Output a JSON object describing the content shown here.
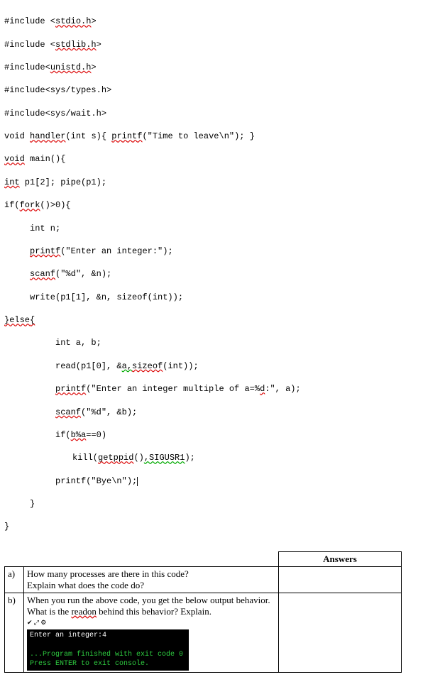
{
  "code": {
    "l1a": "#include <",
    "l1b": "stdio.h",
    "l1c": ">",
    "l2a": "#include <",
    "l2b": "stdlib.h",
    "l2c": ">",
    "l3": "#include<",
    "l3b": "unistd.h",
    "l3c": ">",
    "l4": "#include<sys/types.h>",
    "l5": "#include<sys/wait.h>",
    "l6a": "void ",
    "l6b": "handler",
    "l6c": "(int s){ ",
    "l6d": "printf",
    "l6e": "(\"Time to leave\\n\"); }",
    "l7a": "void",
    "l7b": " main(){",
    "l8a": "int",
    "l8b": " p1[2]; pipe(p1);",
    "l9a": "if(",
    "l9b": "fork",
    "l9c": "()>0){",
    "l10": "int n;",
    "l11a": "printf",
    "l11b": "(\"Enter an integer:\");",
    "l12a": "scanf",
    "l12b": "(\"%d\", &n);",
    "l13": "write(p1[1], &n, sizeof(int));",
    "l14a": "}",
    "l14b": "else",
    "l14c": "{",
    "l15": "int a, b;",
    "l16a": "read(p1[0], &",
    "l16b": "a,",
    "l16c": "sizeof",
    "l16d": "(int));",
    "l17a": "printf",
    "l17b": "(\"Enter an integer multiple of a=%",
    "l17c": "d",
    "l17d": ":\", a);",
    "l18a": "scanf",
    "l18b": "(\"%d\", &b);",
    "l19a": "if(",
    "l19b": "b%a",
    "l19c": "==0)",
    "l20a": "kill(",
    "l20b": "getppid",
    "l20c": "()",
    "l20d": ",SIGUSR1",
    "l20e": ");",
    "l21": "printf(\"Bye\\n\");",
    "l22": "}",
    "l23": "}"
  },
  "table": {
    "answers_header": "Answers",
    "qa_label_a": "a)",
    "qa_label_b": "b)",
    "qa_a_text1": "How many processes are there in this code?",
    "qa_a_text2": "Explain what does the code do?",
    "qa_b_text1": "When you run the above code, you get the below output behavior. What is the ",
    "qa_b_wavy": "readon",
    "qa_b_text2": " behind this behavior? Explain."
  },
  "console": {
    "icons": "✔   ⤢   ⚙",
    "line1": "Enter an integer:4",
    "line2": "...Program finished with exit code 0",
    "line3": "Press ENTER to exit console."
  }
}
